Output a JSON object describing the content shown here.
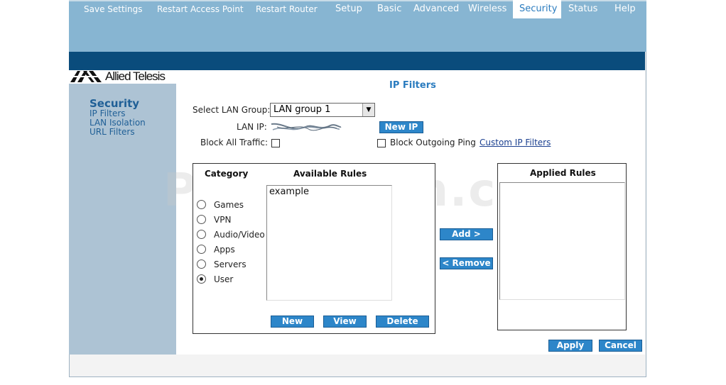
{
  "nav": {
    "items": [
      {
        "label": "Save Settings"
      },
      {
        "label": "Restart Access Point"
      },
      {
        "label": "Restart Router"
      },
      {
        "label": "Setup"
      },
      {
        "label": "Basic"
      },
      {
        "label": "Advanced"
      },
      {
        "label": "Wireless"
      },
      {
        "label": "Security"
      },
      {
        "label": "Status"
      },
      {
        "label": "Help"
      }
    ],
    "active": "Security"
  },
  "logo": {
    "text": "Allied Telesis"
  },
  "sidebar": {
    "title": "Security",
    "links": [
      "IP Filters",
      "LAN Isolation",
      "URL Filters"
    ]
  },
  "page": {
    "title": "IP Filters",
    "lan_group_label": "Select LAN Group:",
    "lan_group_value": "LAN group 1",
    "lan_ip_label": "LAN IP:",
    "new_ip_button": "New IP",
    "block_all_label": "Block All Traffic:",
    "block_ping_label": "Block Outgoing Ping",
    "custom_filters_link": "Custom IP Filters"
  },
  "rules_panel": {
    "category_header": "Category",
    "available_header": "Available Rules",
    "categories": [
      "Games",
      "VPN",
      "Audio/Video",
      "Apps",
      "Servers",
      "User"
    ],
    "selected_category": "User",
    "available_rules": [
      "example"
    ],
    "buttons": {
      "new": "New",
      "view": "View",
      "delete": "Delete"
    }
  },
  "transfer": {
    "add": "Add >",
    "remove": "< Remove"
  },
  "applied_panel": {
    "header": "Applied Rules"
  },
  "footer": {
    "apply": "Apply",
    "cancel": "Cancel"
  },
  "watermark": "PcWinTech.com",
  "colors": {
    "nav_bg": "#0a4c7c",
    "banner": "#87b5d2",
    "accent": "#2d86c9",
    "sidebar": "#adc3d4"
  }
}
